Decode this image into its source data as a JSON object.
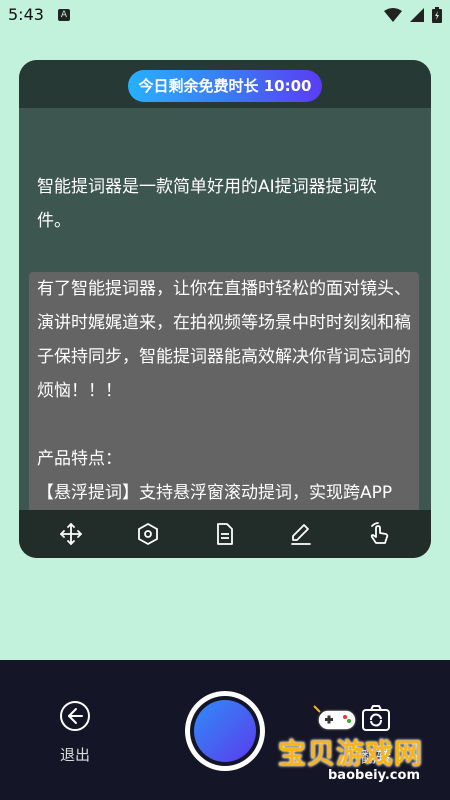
{
  "status_bar": {
    "time": "5:43",
    "notification_icon": "A"
  },
  "card": {
    "timer_pill": "今日剩余免费时长 10:00",
    "intro": "智能提词器是一款简单好用的AI提词器提词软件。",
    "body_lines": [
      "有了智能提词器，让你在直播时轻松的面对镜头、演讲时娓娓道来，在拍视频等场景中时时刻刻和稿子保持同步，智能提词器能高效解决你背词忘词的烦恼！！！"
    ],
    "features_title": "产品特点：",
    "feature_1": "【悬浮提词】支持悬浮窗滚动提词，实现跨APP",
    "toolbar_icons": [
      "move-icon",
      "settings-hexagon-icon",
      "document-icon",
      "edit-pencil-icon",
      "touch-gesture-icon"
    ]
  },
  "bottom_bar": {
    "exit_label": "退出",
    "switch_label": "翻转"
  },
  "watermark": {
    "text": "宝贝游戏网",
    "url": "baobeiy.com"
  },
  "colors": {
    "background": "#c2f2dc",
    "card": "#3d5650",
    "bottom_bar": "#141527",
    "accent_gradient_start": "#28b0ff",
    "accent_gradient_end": "#5b3cf3"
  }
}
